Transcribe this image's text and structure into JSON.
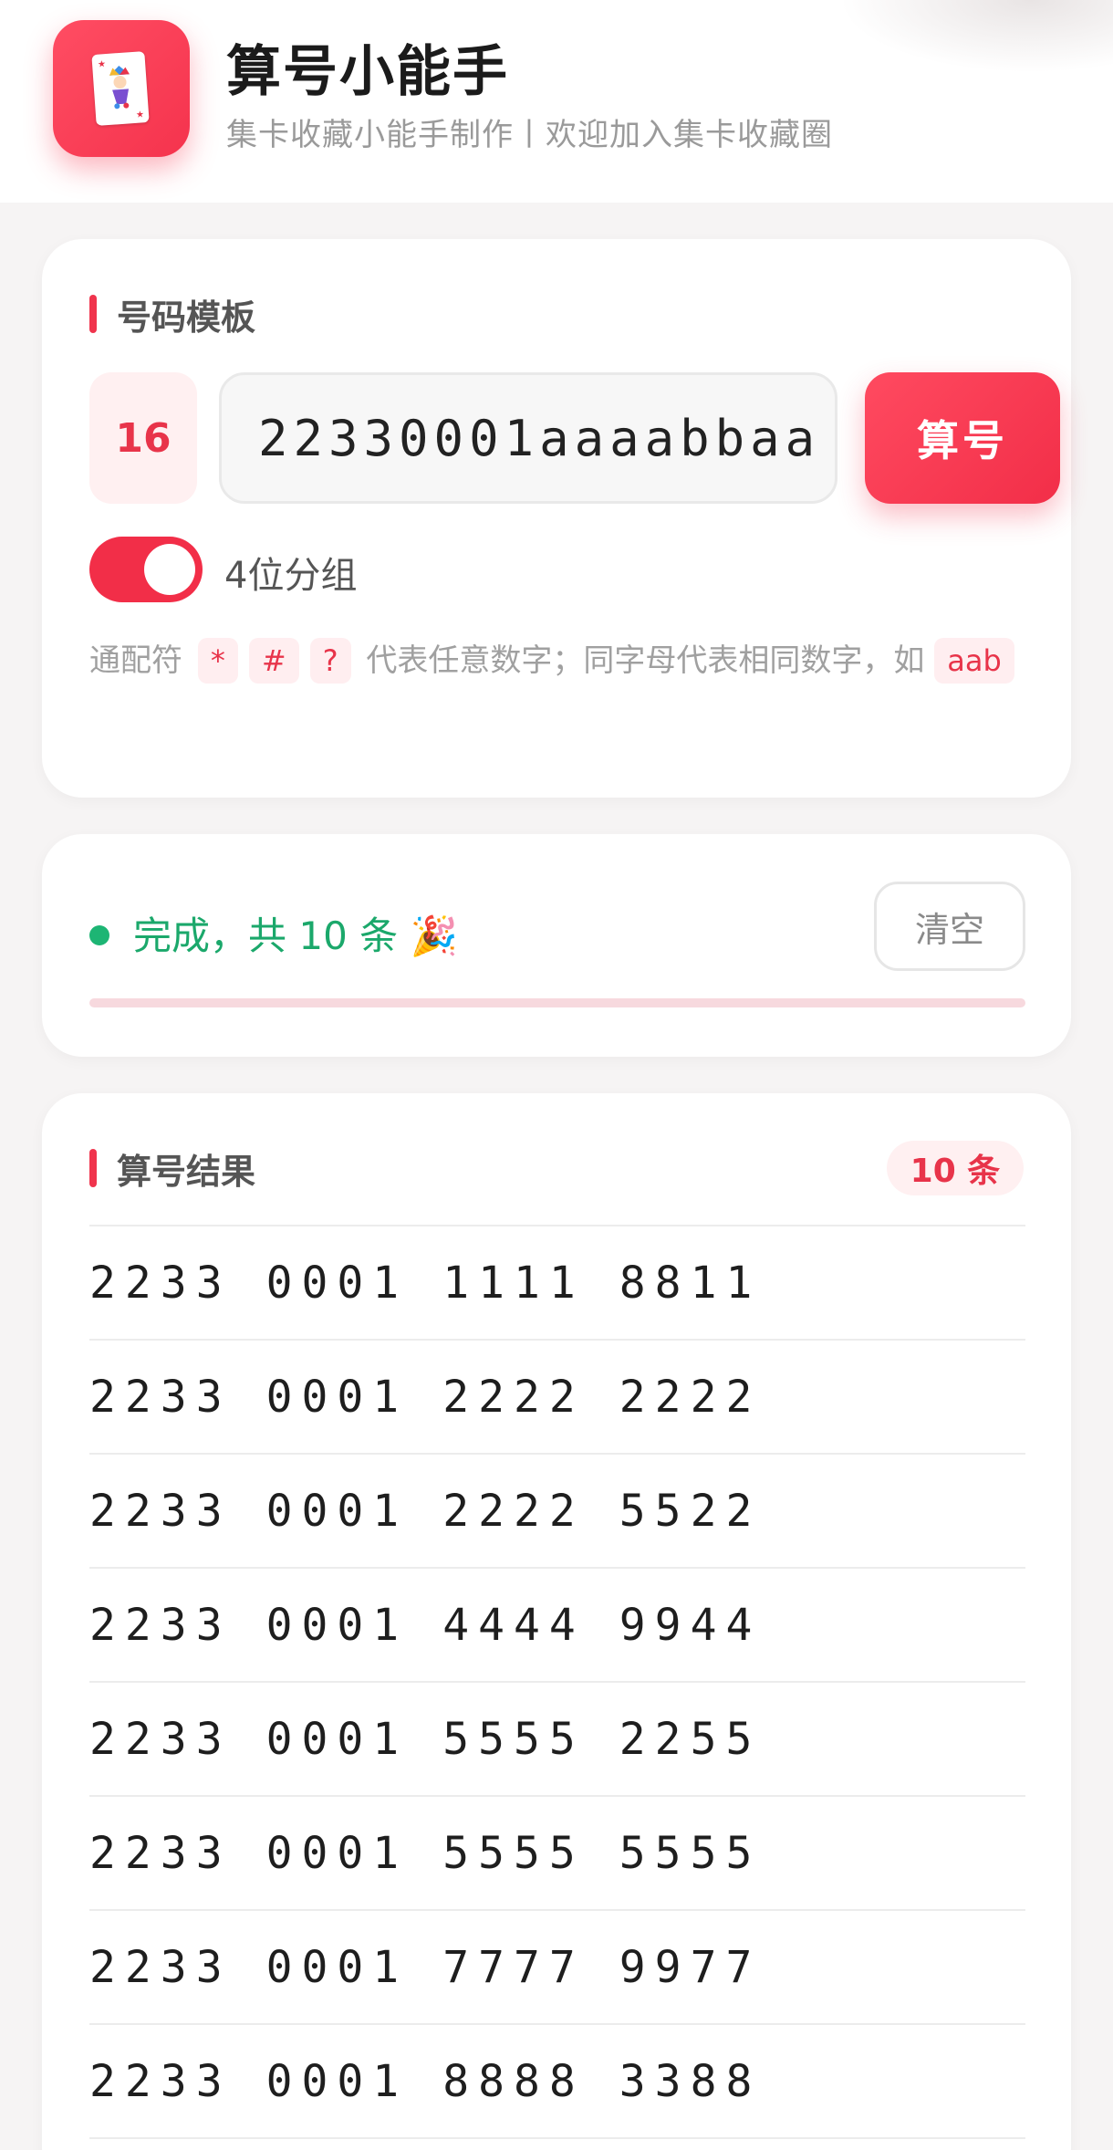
{
  "header": {
    "title": "算号小能手",
    "subtitle": "集卡收藏小能手制作丨欢迎加入集卡收藏圈",
    "icon": "joker-card-icon"
  },
  "template_section": {
    "title": "号码模板",
    "digit_count": "16",
    "template_value": "22330001aaaabbaa",
    "calc_button": "算号",
    "group_toggle_label": "4位分组",
    "group_toggle_on": true,
    "hint_prefix": "通配符",
    "wildcards": [
      "*",
      "#",
      "?"
    ],
    "hint_middle": "代表任意数字；同字母代表相同数字，如",
    "example": "aab"
  },
  "status": {
    "text": "完成，共 10 条 🎉",
    "clear_button": "清空",
    "progress": 1.0,
    "status_color": "#1ba86b"
  },
  "results": {
    "title": "算号结果",
    "count_badge": "10 条",
    "rows": [
      [
        "2233",
        "0001",
        "1111",
        "8811"
      ],
      [
        "2233",
        "0001",
        "2222",
        "2222"
      ],
      [
        "2233",
        "0001",
        "2222",
        "5522"
      ],
      [
        "2233",
        "0001",
        "4444",
        "9944"
      ],
      [
        "2233",
        "0001",
        "5555",
        "2255"
      ],
      [
        "2233",
        "0001",
        "5555",
        "5555"
      ],
      [
        "2233",
        "0001",
        "7777",
        "9977"
      ],
      [
        "2233",
        "0001",
        "8888",
        "3388"
      ]
    ]
  },
  "colors": {
    "accent": "#f22e48",
    "success": "#1db574",
    "background": "#f6f4f4"
  }
}
